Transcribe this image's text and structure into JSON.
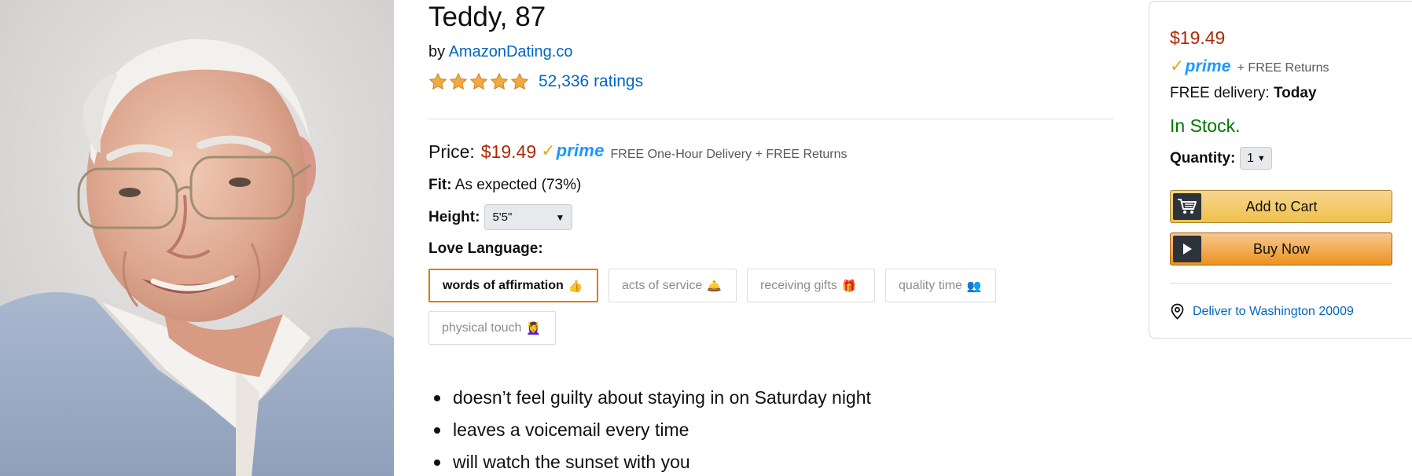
{
  "product": {
    "title": "Teddy, 87",
    "by_prefix": "by",
    "brand": "AmazonDating.co",
    "rating_count": "52,336 ratings",
    "stars": 5,
    "price_label": "Price:",
    "price": "$19.49",
    "prime_logo": "prime",
    "delivery_note": "FREE One-Hour Delivery + FREE Returns",
    "fit_label": "Fit:",
    "fit_value": "As expected (73%)",
    "height_label": "Height:",
    "height_value": "5'5\"",
    "love_language_label": "Love Language:",
    "love_languages": [
      {
        "label": "words of affirmation",
        "emoji": "👍",
        "selected": true
      },
      {
        "label": "acts of service",
        "emoji": "🛎️",
        "selected": false
      },
      {
        "label": "receiving gifts",
        "emoji": "🎁",
        "selected": false
      },
      {
        "label": "quality time",
        "emoji": "👥",
        "selected": false
      },
      {
        "label": "physical touch",
        "emoji": "💆‍♀️",
        "selected": false
      }
    ],
    "bullets": [
      "doesn’t feel guilty about staying in on Saturday night",
      "leaves a voicemail every time",
      "will watch the sunset with you"
    ]
  },
  "buybox": {
    "price": "$19.49",
    "prime_logo": "prime",
    "returns": "+ FREE Returns",
    "delivery_prefix": "FREE delivery:",
    "delivery_day": "Today",
    "stock": "In Stock.",
    "quantity_label": "Quantity:",
    "quantity_value": "1",
    "add_to_cart": "Add to Cart",
    "buy_now": "Buy Now",
    "deliver_to": "Deliver to Washington 20009"
  },
  "colors": {
    "price_red": "#b12704",
    "link_blue": "#0066c0",
    "stock_green": "#007600",
    "prime_blue": "#1a98ff",
    "prime_check": "#f0a51f",
    "selected_border": "#e77600",
    "star_gold": "#f3a847"
  },
  "icons": {
    "star": "star-icon",
    "prime_check": "check-icon",
    "cart": "cart-icon",
    "play": "play-icon",
    "location": "location-pin-icon",
    "caret": "caret-down-icon"
  }
}
